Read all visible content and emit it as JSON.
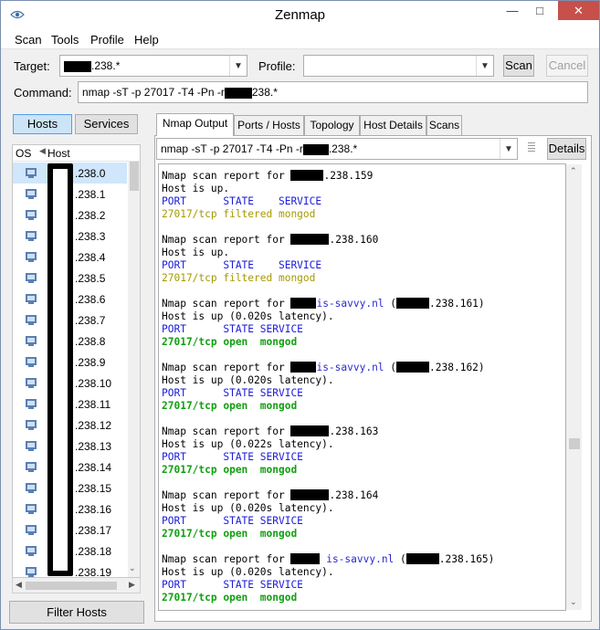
{
  "window": {
    "title": "Zenmap"
  },
  "menu": [
    "Scan",
    "Tools",
    "Profile",
    "Help"
  ],
  "target": {
    "label": "Target:",
    "value": ".238.*"
  },
  "profile": {
    "label": "Profile:",
    "value": ""
  },
  "buttons": {
    "scan": "Scan",
    "cancel": "Cancel",
    "details": "Details",
    "filter_hosts": "Filter Hosts"
  },
  "command": {
    "label": "Command:",
    "prefix": "nmap -sT -p 27017 -T4 -Pn -r",
    "suffix": "238.*"
  },
  "left_toggle": {
    "hosts": "Hosts",
    "services": "Services"
  },
  "host_list": {
    "columns": {
      "os": "OS",
      "host": "Host"
    },
    "hosts": [
      ".238.0",
      ".238.1",
      ".238.2",
      ".238.3",
      ".238.4",
      ".238.5",
      ".238.6",
      ".238.7",
      ".238.8",
      ".238.9",
      ".238.10",
      ".238.11",
      ".238.12",
      ".238.13",
      ".238.14",
      ".238.15",
      ".238.16",
      ".238.17",
      ".238.18",
      ".238.19"
    ]
  },
  "tabs": [
    "Nmap Output",
    "Ports / Hosts",
    "Topology",
    "Host Details",
    "Scans"
  ],
  "output_selector": {
    "prefix": "nmap -sT -p 27017 -T4 -Pn -r",
    "suffix": ".238.*"
  },
  "output": {
    "r1_head": "Nmap scan report for ",
    "r1_ip": ".238.159",
    "r1_up": "Host is up.",
    "r1_cols": "PORT      STATE    SERVICE",
    "r1_port": "27017/tcp filtered mongod",
    "r2_head": "Nmap scan report for ",
    "r2_ip": ".238.160",
    "r2_up": "Host is up.",
    "r2_cols": "PORT      STATE    SERVICE",
    "r2_port": "27017/tcp filtered mongod",
    "r3_head": "Nmap scan report for ",
    "r3_host": "is-savvy.nl",
    "r3_ip": ".238.161",
    "r3_up": "Host is up (0.020s latency).",
    "r3_cols": "PORT      STATE SERVICE",
    "r3_port": "27017/tcp open  mongod",
    "r4_head": "Nmap scan report for ",
    "r4_host": "is-savvy.nl",
    "r4_ip": ".238.162",
    "r4_up": "Host is up (0.020s latency).",
    "r4_cols": "PORT      STATE SERVICE",
    "r4_port": "27017/tcp open  mongod",
    "r5_head": "Nmap scan report for ",
    "r5_ip": ".238.163",
    "r5_up": "Host is up (0.022s latency).",
    "r5_cols": "PORT      STATE SERVICE",
    "r5_port": "27017/tcp open  mongod",
    "r6_head": "Nmap scan report for ",
    "r6_ip": ".238.164",
    "r6_up": "Host is up (0.020s latency).",
    "r6_cols": "PORT      STATE SERVICE",
    "r6_port": "27017/tcp open  mongod",
    "r7_head": "Nmap scan report for ",
    "r7_host": "is-savvy.nl",
    "r7_ip": ".238.165",
    "r7_up": "Host is up (0.020s latency).",
    "r7_cols": "PORT      STATE SERVICE",
    "r7_port": "27017/tcp open  mongod"
  },
  "colors": {
    "port_header": "#1a1adb",
    "filtered": "#a59a00",
    "open": "#12a012",
    "selection": "#cfe6fb",
    "close_button": "#c7504b"
  }
}
